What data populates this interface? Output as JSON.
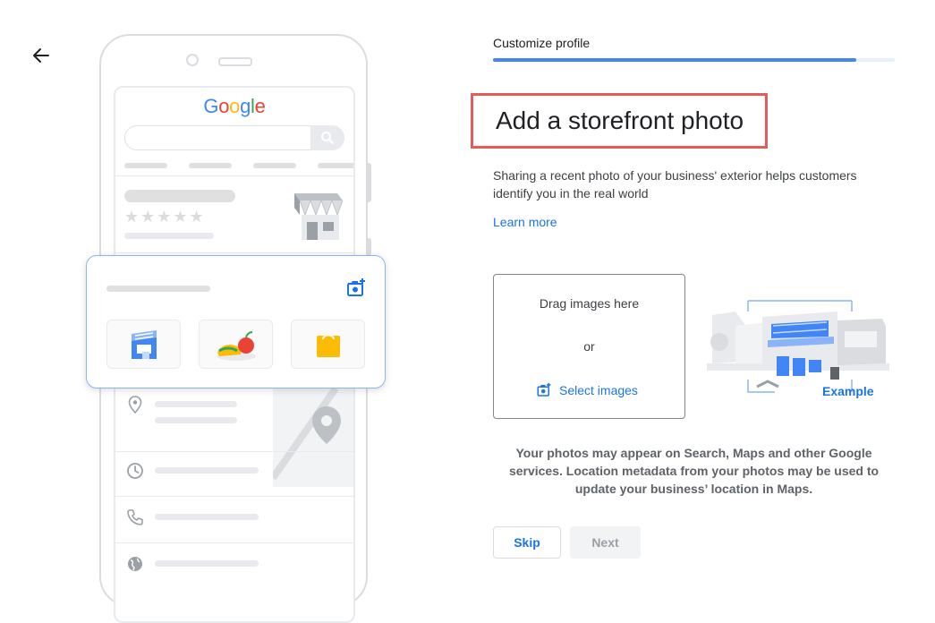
{
  "header": {
    "back_icon": "arrow-back-icon",
    "step_label": "Customize profile",
    "progress": 0.904,
    "accent_color": "#4285f4"
  },
  "preview": {
    "brand_logo": {
      "text": "Google",
      "letter_colors": [
        "#4285f4",
        "#ea4335",
        "#fbbc05",
        "#4285f4",
        "#34a853",
        "#ea4335"
      ]
    },
    "icons": [
      "search-icon",
      "storefront-icon",
      "add-photo-icon",
      "location-pin-icon",
      "clock-icon",
      "phone-icon",
      "globe-icon"
    ],
    "rating_stars": "★★★★★",
    "category_tiles": [
      "storefront-tile-icon",
      "food-tile-icon",
      "shopping-bag-tile-icon"
    ]
  },
  "main": {
    "title": "Add a storefront photo",
    "highlight_color": "#e25c5c",
    "description": "Sharing a recent photo of your business' exterior helps customers identify you in the real world",
    "learn_more": "Learn more",
    "upload": {
      "drag_text": "Drag images here",
      "or_text": "or",
      "select_label": "Select images",
      "select_icon": "add-photo-icon"
    },
    "example_label": "Example",
    "notice": "Your photos may appear on Search, Maps and other Google services. Location metadata from your photos may be used to update your business’ location in Maps."
  },
  "actions": {
    "skip_label": "Skip",
    "next_label": "Next"
  }
}
